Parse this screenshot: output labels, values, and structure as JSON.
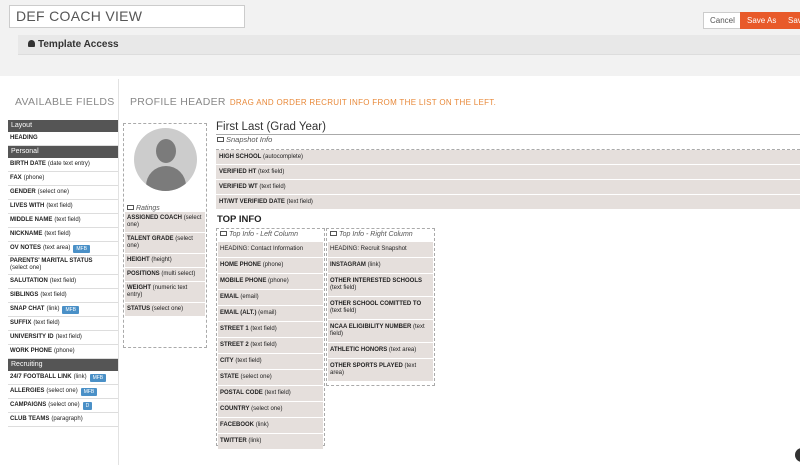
{
  "header": {
    "template_name": "DEF COACH VIEW",
    "cancel_label": "Cancel",
    "save_as_label": "Save As",
    "save_label": "Save",
    "template_access_label": "Template Access"
  },
  "available_fields": {
    "title": "AVAILABLE FIELDS",
    "groups": [
      {
        "name": "Layout",
        "items": [
          {
            "label": "HEADING",
            "type": ""
          }
        ]
      },
      {
        "name": "Personal",
        "items": [
          {
            "label": "BIRTH DATE",
            "type": "(date text entry)"
          },
          {
            "label": "FAX",
            "type": "(phone)"
          },
          {
            "label": "GENDER",
            "type": "(select one)"
          },
          {
            "label": "LIVES WITH",
            "type": "(text field)"
          },
          {
            "label": "MIDDLE NAME",
            "type": "(text field)"
          },
          {
            "label": "NICKNAME",
            "type": "(text field)"
          },
          {
            "label": "OV NOTES",
            "type": "(text area)",
            "badge": "MFB"
          },
          {
            "label": "PARENTS' MARITAL STATUS",
            "type": "(select one)"
          },
          {
            "label": "SALUTATION",
            "type": "(text field)"
          },
          {
            "label": "SIBLINGS",
            "type": "(text field)"
          },
          {
            "label": "SNAP CHAT",
            "type": "(link)",
            "badge": "MFB"
          },
          {
            "label": "SUFFIX",
            "type": "(text field)"
          },
          {
            "label": "UNIVERSITY ID",
            "type": "(text field)"
          },
          {
            "label": "WORK PHONE",
            "type": "(phone)"
          }
        ]
      },
      {
        "name": "Recruiting",
        "items": [
          {
            "label": "24/7 FOOTBALL LINK",
            "type": "(link)",
            "badge": "MFB"
          },
          {
            "label": "ALLERGIES",
            "type": "(select one)",
            "badge": "MFB"
          },
          {
            "label": "CAMPAIGNS",
            "type": "(select one)",
            "badge": "D"
          },
          {
            "label": "CLUB TEAMS",
            "type": "(paragraph)"
          }
        ]
      }
    ]
  },
  "profile_header": {
    "title": "PROFILE HEADER",
    "hint": "DRAG AND ORDER RECRUIT INFO FROM THE LIST ON THE LEFT."
  },
  "profile": {
    "name_line": "First Last (Grad Year)",
    "ratings_label": "Ratings",
    "ratings_items": [
      {
        "label": "ASSIGNED COACH",
        "type": "(select one)"
      },
      {
        "label": "TALENT GRADE",
        "type": "(select one)"
      },
      {
        "label": "HEIGHT",
        "type": "(height)"
      },
      {
        "label": "POSITIONS",
        "type": "(multi select)"
      },
      {
        "label": "WEIGHT",
        "type": "(numeric text entry)"
      },
      {
        "label": "STATUS",
        "type": "(select one)"
      }
    ],
    "snapshot_label": "Snapshot Info",
    "snapshot_items": [
      {
        "label": "HIGH SCHOOL",
        "type": "(autocomplete)"
      },
      {
        "label": "VERIFIED HT",
        "type": "(text field)"
      },
      {
        "label": "VERIFIED WT",
        "type": "(text field)"
      },
      {
        "label": "HT/WT VERIFIED DATE",
        "type": "(text field)"
      }
    ]
  },
  "top_info": {
    "title": "TOP INFO",
    "left_label": "Top Info - Left Column",
    "left_items": [
      {
        "label": "HEADING: Contact Information",
        "type": "",
        "plain": true
      },
      {
        "label": "HOME PHONE",
        "type": "(phone)"
      },
      {
        "label": "MOBILE PHONE",
        "type": "(phone)"
      },
      {
        "label": "EMAIL",
        "type": "(email)"
      },
      {
        "label": "EMAIL (ALT.)",
        "type": "(email)"
      },
      {
        "label": "STREET 1",
        "type": "(text field)"
      },
      {
        "label": "STREET 2",
        "type": "(text field)"
      },
      {
        "label": "CITY",
        "type": "(text field)"
      },
      {
        "label": "STATE",
        "type": "(select one)"
      },
      {
        "label": "POSTAL CODE",
        "type": "(text field)"
      },
      {
        "label": "COUNTRY",
        "type": "(select one)"
      },
      {
        "label": "FACEBOOK",
        "type": "(link)"
      },
      {
        "label": "TWITTER",
        "type": "(link)"
      }
    ],
    "right_label": "Top Info - Right Column",
    "right_items": [
      {
        "label": "HEADING: Recruit Snapshot",
        "type": "",
        "plain": true
      },
      {
        "label": "INSTAGRAM",
        "type": "(link)"
      },
      {
        "label": "OTHER INTERESTED SCHOOLS",
        "type": "(text field)"
      },
      {
        "label": "OTHER SCHOOL COMITTED TO",
        "type": "(text field)"
      },
      {
        "label": "NCAA ELIGIBILITY NUMBER",
        "type": "(text field)"
      },
      {
        "label": "ATHLETIC HONORS",
        "type": "(text area)"
      },
      {
        "label": "OTHER SPORTS PLAYED",
        "type": "(text area)"
      }
    ]
  }
}
